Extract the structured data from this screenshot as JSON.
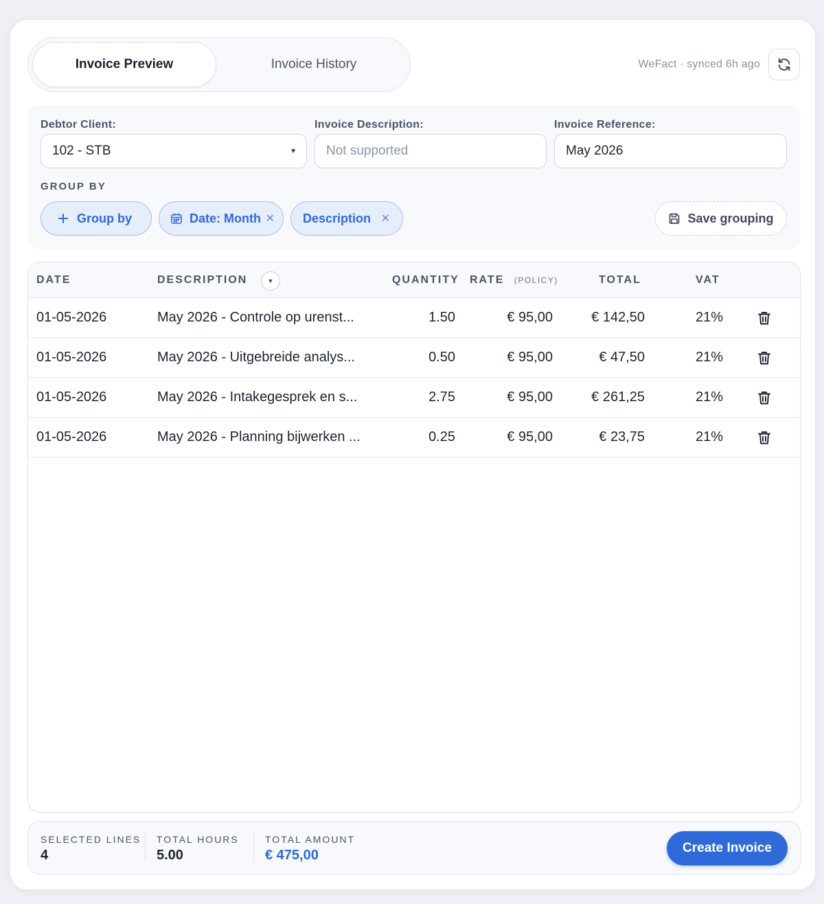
{
  "tabs": {
    "preview": "Invoice Preview",
    "history": "Invoice History"
  },
  "sync": {
    "status": "WeFact · synced 6h ago"
  },
  "filters": {
    "debtor_label": "Debtor Client:",
    "debtor_value": "102 - STB",
    "description_label": "Invoice Description:",
    "description_placeholder": "Not supported",
    "reference_label": "Invoice Reference:",
    "reference_value": "May 2026"
  },
  "group_by": {
    "label": "GROUP BY",
    "add_label": "Group by",
    "chips": [
      {
        "label": "Date: Month"
      },
      {
        "label": "Description"
      }
    ],
    "save_label": "Save grouping"
  },
  "table": {
    "headers": {
      "date": "DATE",
      "description": "DESCRIPTION",
      "quantity": "QUANTITY",
      "rate": "RATE",
      "rate_note": "(POLICY)",
      "total": "TOTAL",
      "vat": "VAT"
    },
    "rows": [
      {
        "date": "01-05-2026",
        "description": "May 2026 - Controle op urenst...",
        "quantity": "1.50",
        "rate": "€ 95,00",
        "total": "€ 142,50",
        "vat": "21%"
      },
      {
        "date": "01-05-2026",
        "description": "May 2026 - Uitgebreide analys...",
        "quantity": "0.50",
        "rate": "€ 95,00",
        "total": "€ 47,50",
        "vat": "21%"
      },
      {
        "date": "01-05-2026",
        "description": "May 2026 - Intakegesprek en s...",
        "quantity": "2.75",
        "rate": "€ 95,00",
        "total": "€ 261,25",
        "vat": "21%"
      },
      {
        "date": "01-05-2026",
        "description": "May 2026 - Planning bijwerken ...",
        "quantity": "0.25",
        "rate": "€ 95,00",
        "total": "€ 23,75",
        "vat": "21%"
      }
    ]
  },
  "footer": {
    "selected_label": "SELECTED LINES",
    "selected_value": "4",
    "hours_label": "TOTAL HOURS",
    "hours_value": "5.00",
    "amount_label": "TOTAL AMOUNT",
    "amount_value": "€ 475,00",
    "create_label": "Create Invoice"
  },
  "colors": {
    "accent": "#2f6ad9",
    "chip_bg": "#e6edfb"
  }
}
